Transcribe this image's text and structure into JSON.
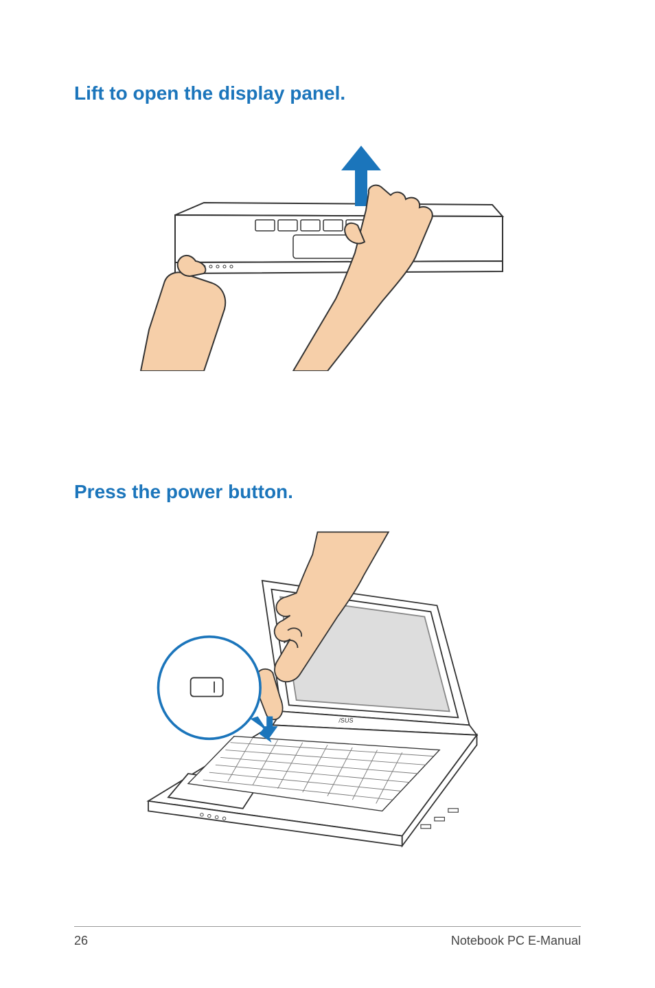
{
  "section1": {
    "heading": "Lift to open the display panel."
  },
  "section2": {
    "heading": "Press the power button."
  },
  "footer": {
    "pageNumber": "26",
    "manualTitle": "Notebook PC E-Manual"
  }
}
